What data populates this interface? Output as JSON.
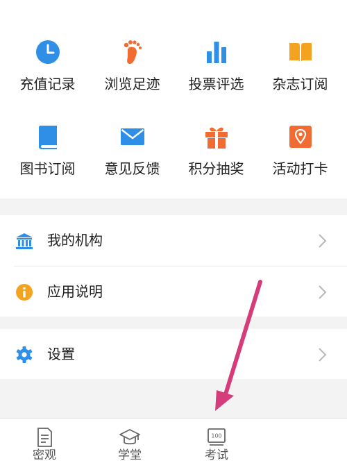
{
  "grid": [
    {
      "label": "充值记录",
      "icon": "clock-icon",
      "color": "#2f8fe6"
    },
    {
      "label": "浏览足迹",
      "icon": "footprint-icon",
      "color": "#f06c32"
    },
    {
      "label": "投票评选",
      "icon": "bar-chart-icon",
      "color": "#2f8fe6"
    },
    {
      "label": "杂志订阅",
      "icon": "open-book-icon",
      "color": "#f3a320"
    },
    {
      "label": "图书订阅",
      "icon": "book-icon",
      "color": "#2f8fe6"
    },
    {
      "label": "意见反馈",
      "icon": "envelope-icon",
      "color": "#2f8fe6"
    },
    {
      "label": "积分抽奖",
      "icon": "gift-icon",
      "color": "#f06c32"
    },
    {
      "label": "活动打卡",
      "icon": "location-pin-icon",
      "color": "#f06c32"
    }
  ],
  "menu": [
    {
      "label": "我的机构",
      "icon": "institution-icon"
    },
    {
      "label": "应用说明",
      "icon": "info-icon"
    },
    {
      "label": "设置",
      "icon": "gear-icon"
    }
  ],
  "tabs": [
    {
      "label": "密观",
      "icon": "document-icon"
    },
    {
      "label": "学堂",
      "icon": "graduation-cap-icon"
    },
    {
      "label": "考试",
      "icon": "exam-icon"
    }
  ],
  "colors": {
    "accent_blue": "#2f8fe6",
    "accent_orange": "#f06c32",
    "accent_yellow": "#f3a320",
    "annotation_arrow": "#d63c7a"
  }
}
